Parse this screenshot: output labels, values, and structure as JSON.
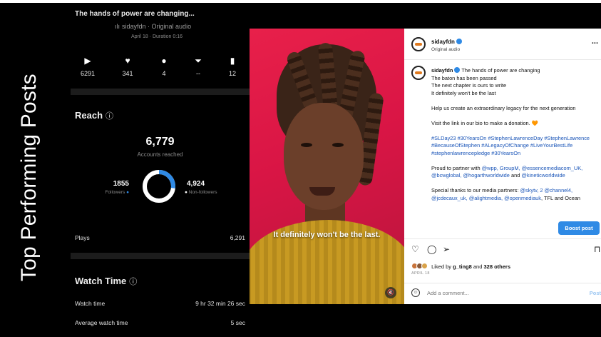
{
  "side_title": "Top Performing Posts",
  "post": {
    "title": "The hands of power are changing...",
    "audio": "sidayfdn · Original audio",
    "meta": "April 18 · Duration 0:16"
  },
  "stats": [
    {
      "icon": "play-icon",
      "glyph": "▶",
      "value": "6291"
    },
    {
      "icon": "heart-icon",
      "glyph": "♥",
      "value": "341"
    },
    {
      "icon": "comment-icon",
      "glyph": "●",
      "value": "4"
    },
    {
      "icon": "send-icon",
      "glyph": "⏷",
      "value": "--"
    },
    {
      "icon": "bookmark-icon",
      "glyph": "▮",
      "value": "12"
    }
  ],
  "reach": {
    "heading": "Reach",
    "info_glyph": "ⓘ",
    "accounts_reached": "6,779",
    "accounts_caption": "Accounts reached",
    "followers": "1855",
    "followers_label": "Followers",
    "non_followers": "4,924",
    "non_followers_label": "Non-followers",
    "followers_share": 0.27,
    "plays_label": "Plays",
    "plays_value": "6,291"
  },
  "watch_time": {
    "heading": "Watch Time",
    "info_glyph": "ⓘ",
    "watch_label": "Watch time",
    "watch_value": "9 hr 32 min 26 sec",
    "avg_label": "Average watch time",
    "avg_value": "5 sec"
  },
  "video": {
    "caption": "It definitely won't be the last.",
    "mute_glyph": "🔇"
  },
  "instagram": {
    "username": "sidayfdn",
    "subtitle": "Original audio",
    "more": "...",
    "caption_lines": [
      "The hands of power are changing",
      "The baton has been passed",
      "The next chapter is ours to write",
      "It definitely won't be the last"
    ],
    "legacy": "Help us create an extraordinary legacy for the next generation",
    "donate": "Visit the link in our bio to make a donation. 🧡",
    "hashtags": "#SLDay23 #30YearsOn #StephenLawrenceDay #StephenLawrence #BecauseOfStephen #ALegacyOfChange #LiveYourBestLife #stephenlawrencepledge #30YearsOn",
    "partner_prefix": "Proud to partner with ",
    "partner_tags": "@wpp, GroupM, @essencemediacom_UK, @bcwglobal, @hogarthworldwide",
    "partner_and": "and ",
    "partner_last": "@kineticworldwide",
    "thanks_prefix": "Special thanks to our media partners: ",
    "thanks_tags": "@skytv, 2 @channel4, @jcdecaux_uk, @alightmedia, @openmediauk",
    "thanks_suffix": ", TFL and Ocean",
    "boost_label": "Boost post",
    "likes_prefix": "Liked by ",
    "likes_user": "g_ting8",
    "likes_mid": " and ",
    "likes_others": "328 others",
    "date": "APRIL 18",
    "comment_placeholder": "Add a comment...",
    "post_label": "Post"
  },
  "colors": {
    "accent_blue": "#2f8ae5",
    "video_red": "#e8204a",
    "panel_bg": "#000000"
  }
}
